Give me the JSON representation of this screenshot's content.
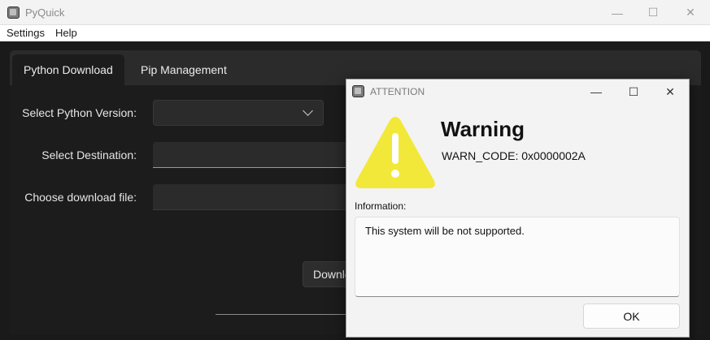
{
  "app": {
    "title": "PyQuick",
    "controls": {
      "minimize": "—",
      "maximize": "☐",
      "close": "✕"
    }
  },
  "menu": [
    "Settings",
    "Help"
  ],
  "tabs": [
    "Python Download",
    "Pip Management"
  ],
  "form": {
    "version_label": "Select Python Version:",
    "version_value": "",
    "destination_label": "Select Destination:",
    "destination_value": "",
    "file_label": "Choose download file:",
    "file_value": "",
    "download_button": "Download"
  },
  "dialog": {
    "title": "ATTENTION",
    "heading": "Warning",
    "code": "WARN_CODE: 0x0000002A",
    "info_label": "Information:",
    "info_text": "This system will be not supported.",
    "ok": "OK",
    "controls": {
      "minimize": "—",
      "maximize": "☐",
      "close": "✕"
    }
  },
  "colors": {
    "warning_yellow": "#f2e83a",
    "dark_bg": "#1c1c1c",
    "panel": "#2b2b2b"
  },
  "icons": {
    "app": "app-icon",
    "warning": "warning-triangle-icon",
    "dropdown": "chevron-down-icon"
  }
}
